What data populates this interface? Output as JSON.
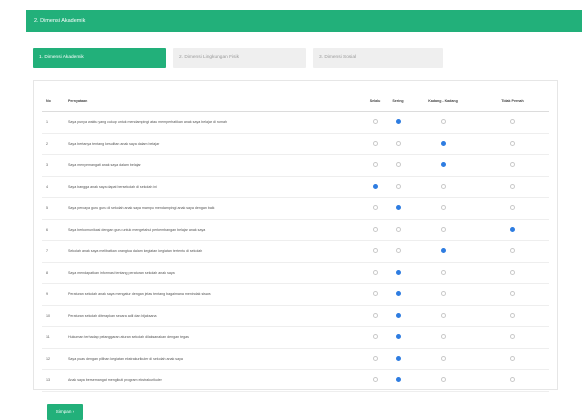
{
  "header": {
    "title": "2. Dimensi Akademik"
  },
  "tabs": [
    {
      "label": "1. Dimensi Akademik",
      "active": true
    },
    {
      "label": "2. Dimensi Lingkungan Fisik",
      "active": false
    },
    {
      "label": "3. Dimensi Sosial",
      "active": false
    }
  ],
  "table": {
    "columns": [
      "No",
      "Pernyataan",
      "Selalu",
      "Sering",
      "Kadang - Kadang",
      "Tidak Pernah"
    ],
    "rows": [
      {
        "no": "1",
        "text": "Saya punya waktu yang cukup untuk mendampingi atau memperhatikan anak saya belajar di rumah",
        "selected": 1
      },
      {
        "no": "2",
        "text": "Saya bertanya tentang kesulitan anak saya dalam belajar",
        "selected": 2
      },
      {
        "no": "3",
        "text": "Saya menyemangati anak saya dalam belajar",
        "selected": 2
      },
      {
        "no": "4",
        "text": "Saya bangga anak saya dapat bersekolah di sekolah ini",
        "selected": 0
      },
      {
        "no": "5",
        "text": "Saya percaya guru guru di sekolah anak saya mampu mendampingi anak saya dengan baik",
        "selected": 1
      },
      {
        "no": "6",
        "text": "Saya berkomunikasi dengan guru untuk mengetahui perkembangan belajar anak saya",
        "selected": 3
      },
      {
        "no": "7",
        "text": "Sekolah anak saya melibatkan orangtua dalam kegiatan kegiatan tertentu di sekolah",
        "selected": 2
      },
      {
        "no": "8",
        "text": "Saya mendapatkan informasi tentang peraturan sekolah anak saya",
        "selected": 1
      },
      {
        "no": "9",
        "text": "Peraturan sekolah anak saya mengatur dengan jelas tentang bagaimana menindak siswa",
        "selected": 1
      },
      {
        "no": "10",
        "text": "Peraturan sekolah diterapkan secara adil dan bijaksana",
        "selected": 1
      },
      {
        "no": "11",
        "text": "Hukuman terhadap pelanggaran aturan sekolah dilaksanakan dengan tegas",
        "selected": 1
      },
      {
        "no": "12",
        "text": "Saya puas dengan pilihan kegiatan ekstrakurikuler di sekolah anak saya",
        "selected": 1
      },
      {
        "no": "13",
        "text": "Anak saya bersemangat mengikuti program ekstrakurikuler",
        "selected": 1
      }
    ]
  },
  "actions": {
    "submit_label": "Simpan ›"
  },
  "colors": {
    "accent": "#22b07a",
    "radio_selected": "#2f7de1"
  }
}
